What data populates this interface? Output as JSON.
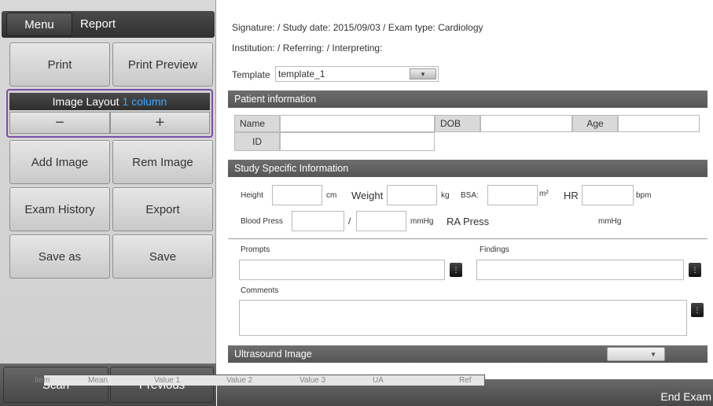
{
  "left": {
    "menu_label": "Menu",
    "report_label": "Report",
    "print_label": "Print",
    "print_preview_label": "Print Preview",
    "image_layout_label": "Image Layout",
    "image_layout_value": "1 column",
    "minus_label": "−",
    "plus_label": "+",
    "add_image_label": "Add Image",
    "rem_image_label": "Rem Image",
    "exam_history_label": "Exam History",
    "export_label": "Export",
    "save_as_label": "Save as",
    "save_label": "Save",
    "scan_label": "Scan",
    "previous_label": "Previous"
  },
  "header": {
    "line1": "Signature:  /  Study date: 2015/09/03  /  Exam type: Cardiology",
    "line2": "Institution:  /  Referring:  /  Interpreting:",
    "template_label": "Template",
    "template_value": "template_1"
  },
  "patient": {
    "section_title": "Patient information",
    "name_label": "Name",
    "dob_label": "DOB",
    "age_label": "Age",
    "id_label": "ID"
  },
  "study": {
    "section_title": "Study Specific Information",
    "height_label": "Height",
    "height_unit": "cm",
    "weight_label": "Weight",
    "weight_unit": "kg",
    "bsa_label": "BSA:",
    "bsa_unit": "m²",
    "hr_label": "HR",
    "hr_unit": "bpm",
    "bp_label": "Blood Press",
    "bp_sep": "/",
    "bp_unit": "mmHg",
    "ra_label": "RA Press",
    "ra_unit": "mmHg"
  },
  "notes": {
    "prompts_label": "Prompts",
    "findings_label": "Findings",
    "comments_label": "Comments"
  },
  "ultrasound": {
    "section_title": "Ultrasound Image",
    "columns": [
      "Item",
      "Mean",
      "Value 1",
      "Value 2",
      "Value 3",
      "UA",
      "Ref"
    ]
  },
  "footer": {
    "end_exam_label": "End Exam"
  },
  "colors": {
    "accent_blue": "#3aa7ff",
    "highlight_purple": "#7a4fa8"
  }
}
